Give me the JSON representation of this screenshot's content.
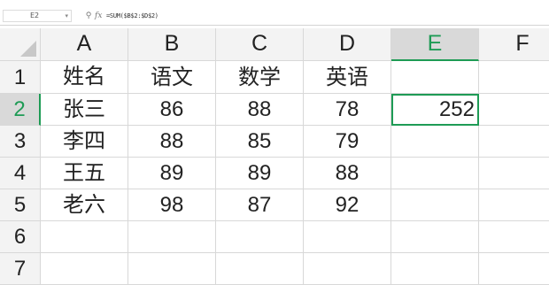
{
  "formula_bar": {
    "name_box": "E2",
    "zoom_icon": "magnifier-icon",
    "fx_label": "fx",
    "formula": "=SUM($B$2:$D$2)"
  },
  "columns": [
    "A",
    "B",
    "C",
    "D",
    "E",
    "F"
  ],
  "rows": [
    "1",
    "2",
    "3",
    "4",
    "5",
    "6",
    "7"
  ],
  "active_cell": {
    "column": "E",
    "row": "2"
  },
  "colors": {
    "accent": "#1e9b55",
    "header_bg": "#f3f3f3",
    "active_header_bg": "#d9d9d9",
    "grid": "#d8d8d8"
  },
  "cells": {
    "A1": "姓名",
    "B1": "语文",
    "C1": "数学",
    "D1": "英语",
    "A2": "张三",
    "B2": "86",
    "C2": "88",
    "D2": "78",
    "E2": "252",
    "A3": "李四",
    "B3": "88",
    "C3": "85",
    "D3": "79",
    "A4": "王五",
    "B4": "89",
    "C4": "89",
    "D4": "88",
    "A5": "老六",
    "B5": "98",
    "C5": "87",
    "D5": "92"
  }
}
